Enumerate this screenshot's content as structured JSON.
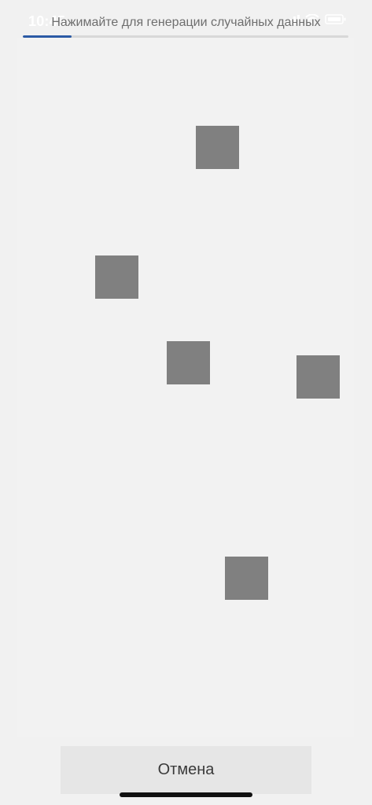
{
  "status_bar": {
    "time": "10:45",
    "signal_icon": "signal-icon",
    "wifi_icon": "wifi-icon",
    "battery_icon": "battery-icon"
  },
  "header": {
    "instruction": "Нажимайте для генерации случайных данных",
    "progress_fraction": 0.15
  },
  "main": {
    "target_items": [
      {
        "label": ""
      },
      {
        "label": ""
      },
      {
        "label": ""
      },
      {
        "label": ""
      },
      {
        "label": ""
      }
    ]
  },
  "footer": {
    "cancel_label": "Отмена"
  },
  "colors": {
    "background": "#f1f1f1",
    "progress": "#2b5aa5",
    "target": "#808080",
    "button": "#e6e6e6"
  }
}
